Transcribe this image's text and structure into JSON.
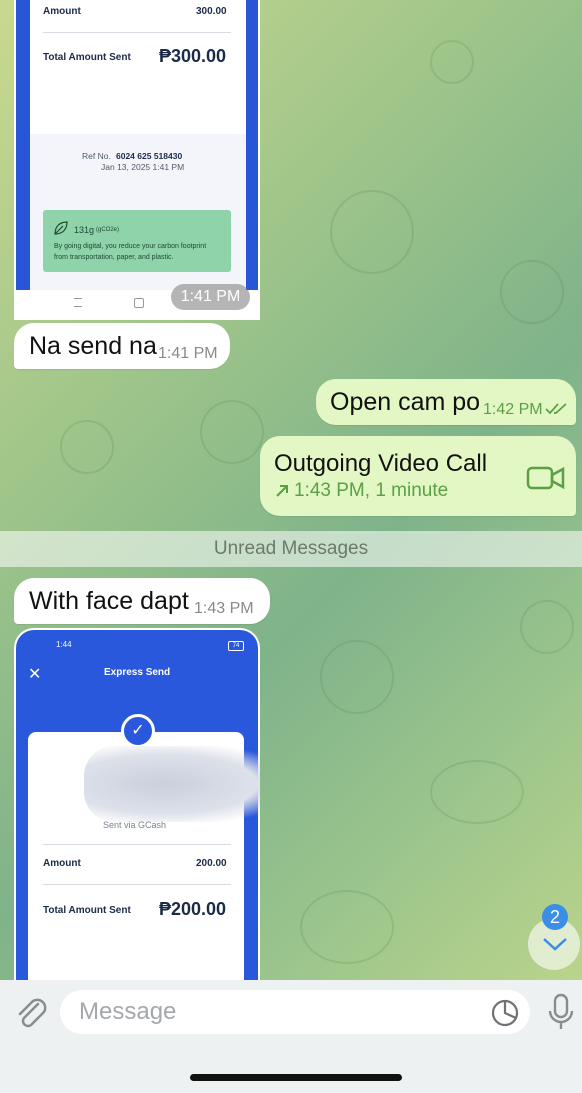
{
  "receipt_top": {
    "amount_label": "Amount",
    "amount_value": "300.00",
    "total_label": "Total Amount Sent",
    "total_value": "₱300.00",
    "ref_label": "Ref No.",
    "ref_number": "6024 625 518430",
    "ref_date": "Jan 13, 2025 1:41 PM",
    "carbon_value": "131g",
    "carbon_unit": "(gCO2e)",
    "carbon_line1": "By going digital, you reduce your carbon footprint",
    "carbon_line2": "from transportation, paper, and plastic.",
    "time": "1:41 PM"
  },
  "messages": [
    {
      "text": "Na send na",
      "time": "1:41 PM",
      "direction": "in"
    },
    {
      "text": "Open cam po",
      "time": "1:42 PM",
      "direction": "out"
    },
    {
      "title": "Outgoing Video Call",
      "detail": "1:43 PM, 1 minute",
      "direction": "out"
    },
    {
      "text": "With face dapt",
      "time": "1:43 PM",
      "direction": "in"
    }
  ],
  "unread_separator": "Unread Messages",
  "receipt_bottom": {
    "status_time": "1:44",
    "battery": "74",
    "title": "Express Send",
    "sent_via": "Sent via GCash",
    "amount_label": "Amount",
    "amount_value": "200.00",
    "total_label": "Total Amount Sent",
    "total_value": "₱200.00"
  },
  "unread_count": "2",
  "input": {
    "placeholder": "Message"
  },
  "colors": {
    "accent": "#5aa046",
    "gcash_blue": "#2a58dc",
    "badge": "#3a8ee6"
  }
}
